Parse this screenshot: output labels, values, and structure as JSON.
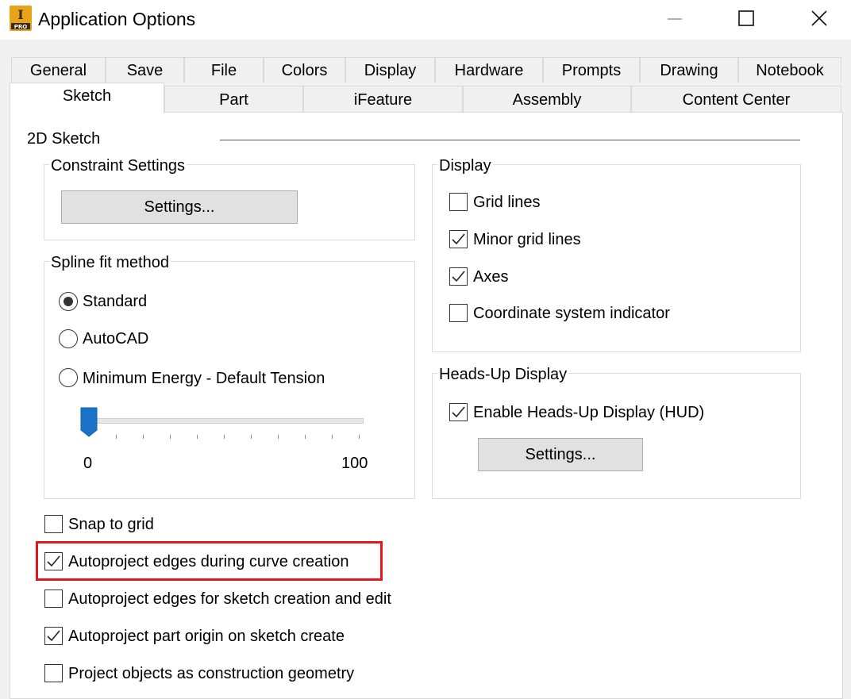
{
  "window": {
    "title": "Application Options",
    "icon_badge": "PRO",
    "icon_letter": "I"
  },
  "tabs_row1": [
    "General",
    "Save",
    "File",
    "Colors",
    "Display",
    "Hardware",
    "Prompts",
    "Drawing",
    "Notebook"
  ],
  "tabs_row2": [
    "Sketch",
    "Part",
    "iFeature",
    "Assembly",
    "Content Center"
  ],
  "active_tab": "Sketch",
  "section_title": "2D Sketch",
  "constraint_settings": {
    "title": "Constraint Settings",
    "button": "Settings..."
  },
  "spline_fit": {
    "title": "Spline fit method",
    "options": [
      {
        "label": "Standard",
        "selected": true
      },
      {
        "label": "AutoCAD",
        "selected": false
      },
      {
        "label": "Minimum Energy - Default Tension",
        "selected": false
      }
    ],
    "slider": {
      "value": 0,
      "min_label": "0",
      "max_label": "100"
    }
  },
  "display": {
    "title": "Display",
    "options": [
      {
        "label": "Grid lines",
        "checked": false
      },
      {
        "label": "Minor grid lines",
        "checked": true
      },
      {
        "label": "Axes",
        "checked": true
      },
      {
        "label": "Coordinate system indicator",
        "checked": false
      }
    ]
  },
  "hud": {
    "title": "Heads-Up Display",
    "option": {
      "label": "Enable Heads-Up Display (HUD)",
      "checked": true
    },
    "button": "Settings..."
  },
  "sketch_options": [
    {
      "label": "Snap to grid",
      "checked": false
    },
    {
      "label": "Autoproject edges during curve creation",
      "checked": true,
      "highlighted": true
    },
    {
      "label": "Autoproject edges for sketch creation and edit",
      "checked": false
    },
    {
      "label": "Autoproject part origin on sketch create",
      "checked": true
    },
    {
      "label": "Project objects as construction geometry",
      "checked": false
    }
  ],
  "colors": {
    "highlight": "#e3171e",
    "slider_thumb": "#1a73c9",
    "icon_bg": "#e8a317"
  }
}
